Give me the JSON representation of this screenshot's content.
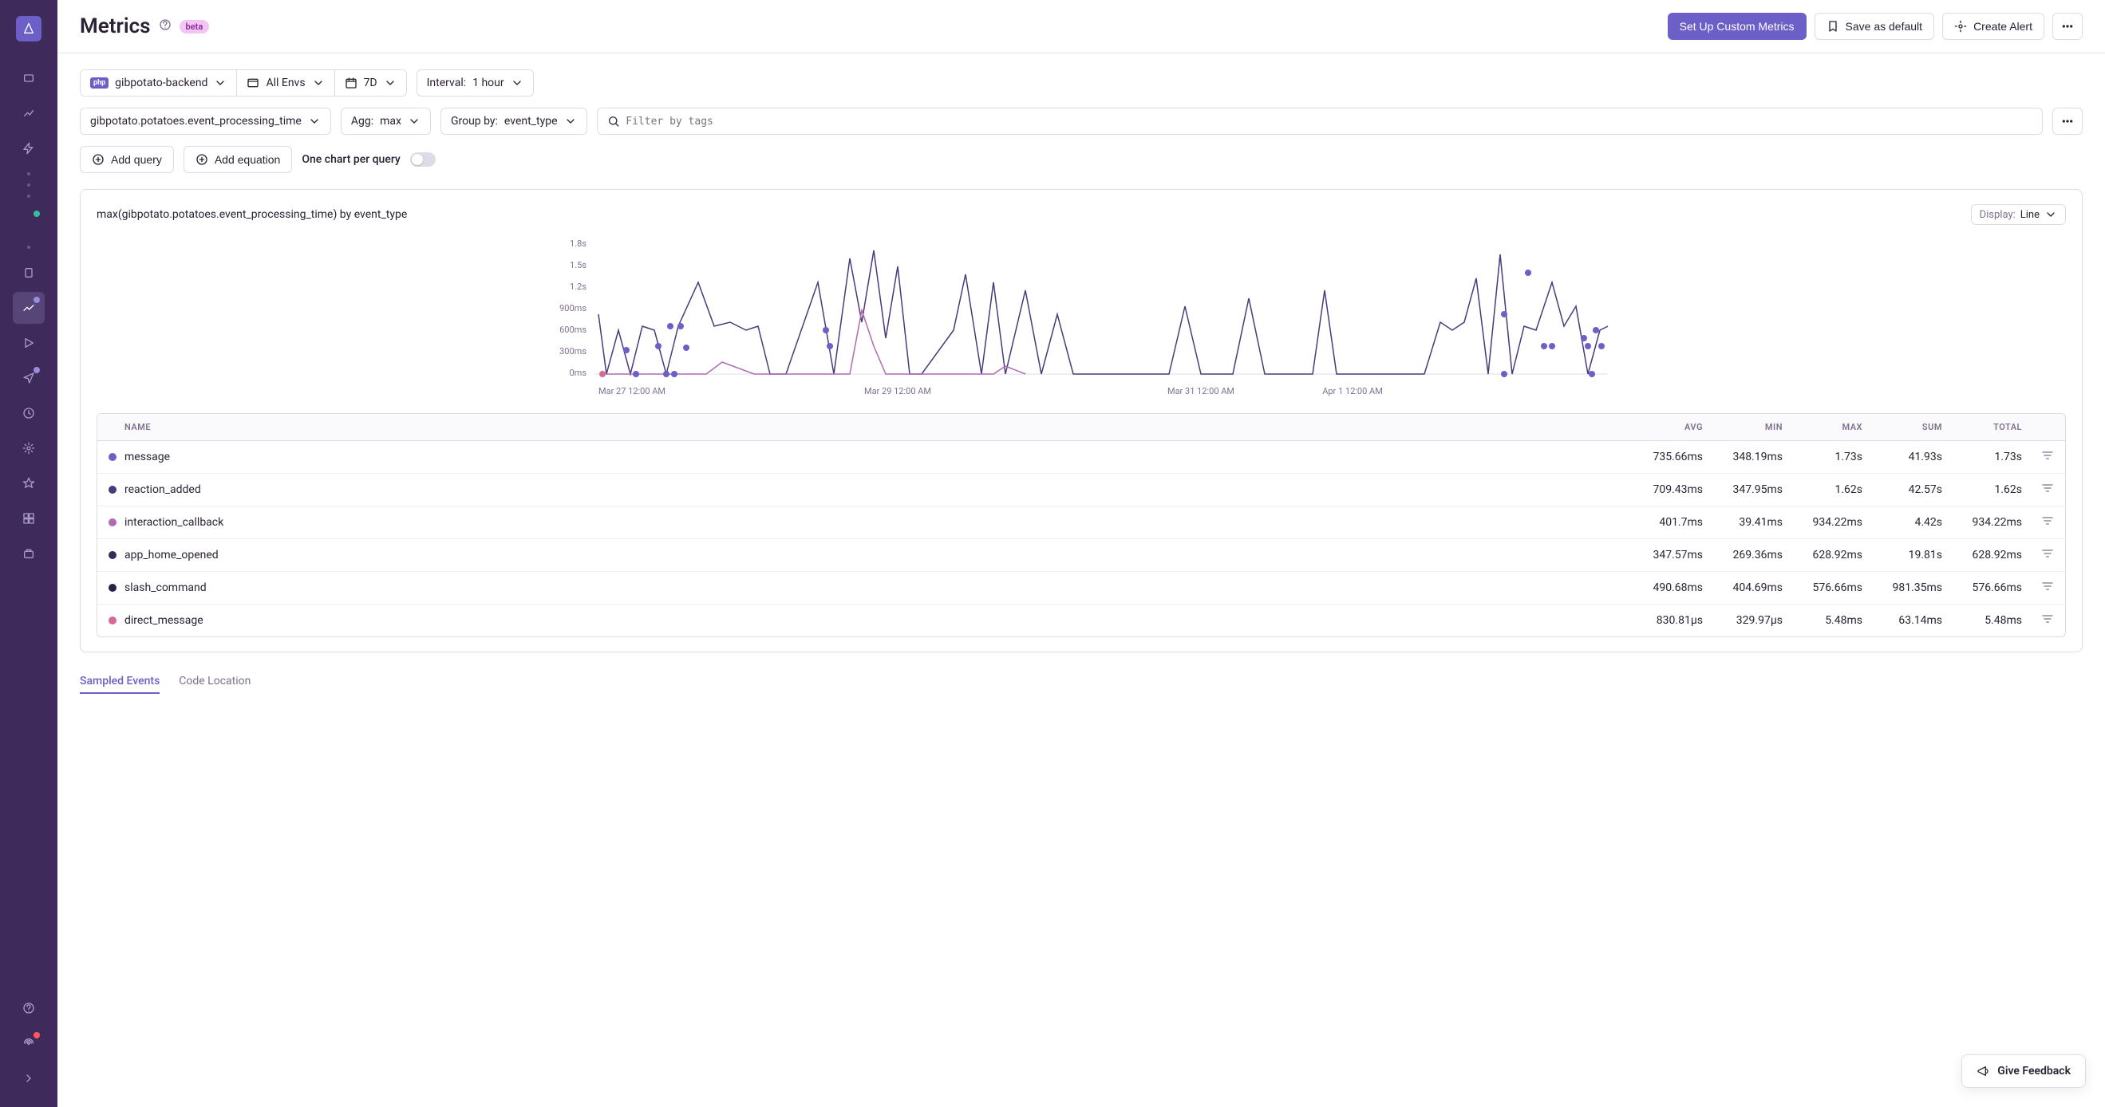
{
  "header": {
    "title": "Metrics",
    "beta": "beta",
    "setup_btn": "Set Up Custom Metrics",
    "save_btn": "Save as default",
    "alert_btn": "Create Alert"
  },
  "filters": {
    "project": "gibpotato-backend",
    "env": "All Envs",
    "range": "7D",
    "interval_label": "Interval:",
    "interval_value": "1 hour",
    "metric": "gibpotato.potatoes.event_processing_time",
    "agg_label": "Agg:",
    "agg_value": "max",
    "groupby_label": "Group by:",
    "groupby_value": "event_type",
    "filter_placeholder": "Filter by tags"
  },
  "query_row": {
    "add_query": "Add query",
    "add_equation": "Add equation",
    "one_chart": "One chart per query"
  },
  "chart": {
    "title": "max(gibpotato.potatoes.event_processing_time) by event_type",
    "display_label": "Display:",
    "display_value": "Line"
  },
  "chart_data": {
    "type": "line",
    "ylabel": "",
    "xlabel": "",
    "y_ticks": [
      "0ms",
      "300ms",
      "600ms",
      "900ms",
      "1.2s",
      "1.5s",
      "1.8s"
    ],
    "ylim": [
      0,
      1800
    ],
    "x_ticks": [
      "Mar 27 12:00 AM",
      "Mar 29 12:00 AM",
      "Mar 31 12:00 AM",
      "Apr 1 12:00 AM"
    ],
    "series_colors": {
      "message": "#6c5fc7",
      "reaction_added": "#4a3a7a",
      "interaction_callback": "#b06ab3",
      "app_home_opened": "#3a2a5b",
      "slash_command": "#2b1e4a",
      "direct_message": "#d46a9a"
    }
  },
  "table": {
    "headers": {
      "name": "NAME",
      "avg": "AVG",
      "min": "MIN",
      "max": "MAX",
      "sum": "SUM",
      "total": "TOTAL"
    },
    "rows": [
      {
        "name": "message",
        "color": "#6c5fc7",
        "avg": "735.66ms",
        "min": "348.19ms",
        "max": "1.73s",
        "sum": "41.93s",
        "total": "1.73s"
      },
      {
        "name": "reaction_added",
        "color": "#4a3a7a",
        "avg": "709.43ms",
        "min": "347.95ms",
        "max": "1.62s",
        "sum": "42.57s",
        "total": "1.62s"
      },
      {
        "name": "interaction_callback",
        "color": "#b06ab3",
        "avg": "401.7ms",
        "min": "39.41ms",
        "max": "934.22ms",
        "sum": "4.42s",
        "total": "934.22ms"
      },
      {
        "name": "app_home_opened",
        "color": "#3a2a5b",
        "avg": "347.57ms",
        "min": "269.36ms",
        "max": "628.92ms",
        "sum": "19.81s",
        "total": "628.92ms"
      },
      {
        "name": "slash_command",
        "color": "#2b1e4a",
        "avg": "490.68ms",
        "min": "404.69ms",
        "max": "576.66ms",
        "sum": "981.35ms",
        "total": "576.66ms"
      },
      {
        "name": "direct_message",
        "color": "#d46a9a",
        "avg": "830.81µs",
        "min": "329.97µs",
        "max": "5.48ms",
        "sum": "63.14ms",
        "total": "5.48ms"
      }
    ]
  },
  "bottom_tabs": {
    "sampled": "Sampled Events",
    "code": "Code Location"
  },
  "feedback": "Give Feedback"
}
